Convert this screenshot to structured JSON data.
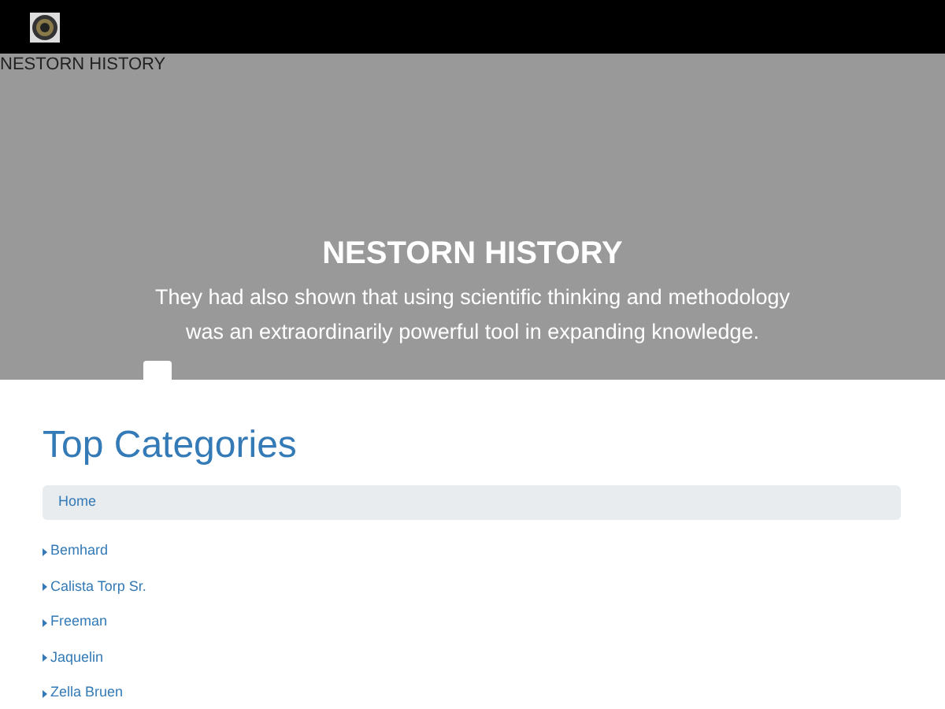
{
  "header": {
    "site_name": "NESTORN HISTORY"
  },
  "hero": {
    "title": "NESTORN HISTORY",
    "subtitle": "They had also shown that using scientific thinking and methodology was an extraordinarily powerful tool in expanding knowledge."
  },
  "section": {
    "title": "Top Categories"
  },
  "breadcrumb": [
    "Home"
  ],
  "categories": [
    "Bemhard",
    "Calista Torp Sr.",
    "Freeman",
    "Jaquelin",
    "Zella Bruen"
  ]
}
